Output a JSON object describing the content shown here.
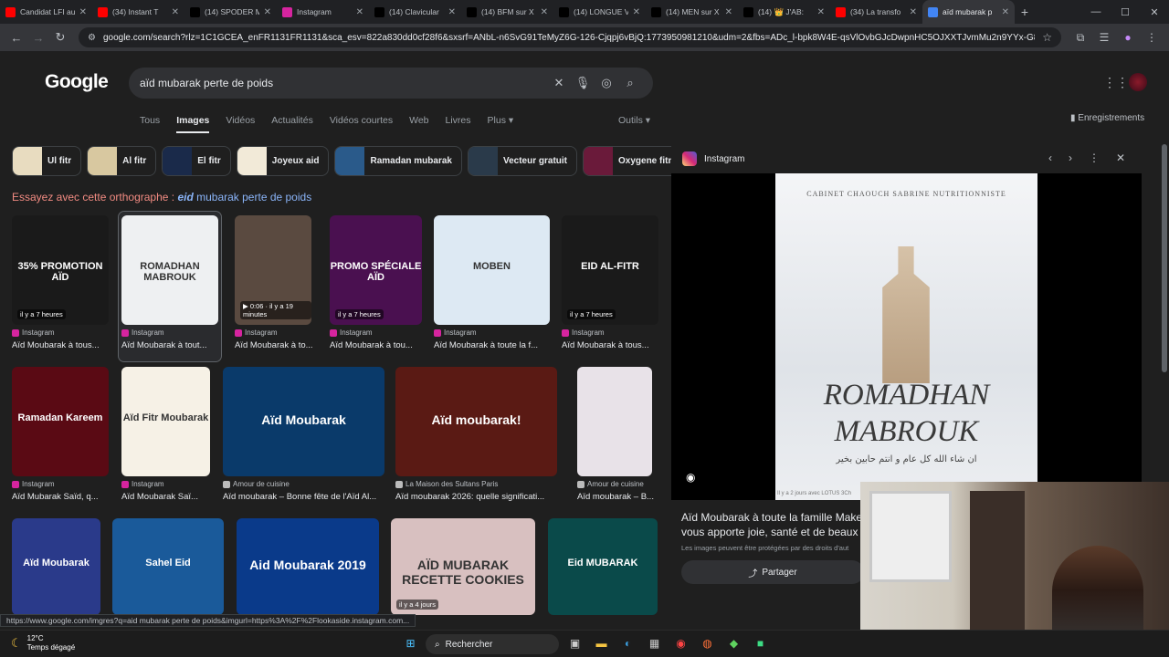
{
  "tabs": [
    {
      "title": "Candidat LFI au",
      "icon": "youtube-icon",
      "color": "#ff0000"
    },
    {
      "title": "(34) Instant T",
      "icon": "youtube-icon",
      "color": "#ff0000"
    },
    {
      "title": "(14) SPODER M",
      "icon": "x-icon",
      "color": "#000000"
    },
    {
      "title": "Instagram",
      "icon": "instagram-icon",
      "color": "#d6249f"
    },
    {
      "title": "(14) Clavicular",
      "icon": "x-icon",
      "color": "#000000"
    },
    {
      "title": "(14) BFM sur X",
      "icon": "x-icon",
      "color": "#000000"
    },
    {
      "title": "(14) LONGUE V",
      "icon": "x-icon",
      "color": "#000000"
    },
    {
      "title": "(14) MEN sur X",
      "icon": "x-icon",
      "color": "#000000"
    },
    {
      "title": "(14) 👑 J'AB:",
      "icon": "x-icon",
      "color": "#000000"
    },
    {
      "title": "(34) La transfo",
      "icon": "youtube-icon",
      "color": "#ff0000"
    },
    {
      "title": "aïd mubarak p",
      "icon": "google-icon",
      "color": "#4285f4"
    }
  ],
  "url": "google.com/search?rlz=1C1GCEA_enFR1131FR1131&sca_esv=822a830dd0cf28f6&sxsrf=ANbL-n6SvG91TeMyZ6G-126-Cjqpj6vBjQ:1773950981210&udm=2&fbs=ADc_l-bpk8W4E-qsVlOvbGJcDwpnHC5OJXXTJvmMu2n9YYx-G8xzgQk24aW1N_FyIND5...",
  "logo": "Google",
  "query": "aïd mubarak perte de poids",
  "navtabs": [
    "Tous",
    "Images",
    "Vidéos",
    "Actualités",
    "Vidéos courtes",
    "Web",
    "Livres",
    "Plus"
  ],
  "outils": "Outils",
  "enregistrements": "Enregistrements",
  "chips": [
    {
      "label": "Ul fitr",
      "color": "#e8dcc0"
    },
    {
      "label": "Al fitr",
      "color": "#d8c8a0"
    },
    {
      "label": "El fitr",
      "color": "#1a2a4a"
    },
    {
      "label": "Joyeux aid",
      "color": "#f2ead8"
    },
    {
      "label": "Ramadan mubarak",
      "color": "#2a5a8a"
    },
    {
      "label": "Vecteur gratuit",
      "color": "#2a3a4a"
    },
    {
      "label": "Oxygene fitness",
      "color": "#6a1a3a"
    }
  ],
  "spell": {
    "prefix": "Essayez avec cette orthographe : ",
    "fix": "eid",
    "rest": " mubarak perte de poids"
  },
  "results": [
    {
      "src": "Instagram",
      "title": "Aïd Moubarak à tous...",
      "badge": "il y a 7 heures",
      "overlay": "35% PROMOTION AÏD",
      "color": "#1a1a1a"
    },
    {
      "src": "Instagram",
      "title": "Aïd Moubarak à tout...",
      "badge": "",
      "overlay": "ROMADHAN MABROUK",
      "color": "#eef0f2"
    },
    {
      "src": "Instagram",
      "title": "Aïd Moubarak à to...",
      "badge": "▶ 0:06 · il y a 19 minutes",
      "overlay": "",
      "color": "#5a4a40"
    },
    {
      "src": "Instagram",
      "title": "Aïd Moubarak à tou...",
      "badge": "il y a 7 heures",
      "overlay": "PROMO SPÉCIALE AÏD",
      "color": "#4a1050"
    },
    {
      "src": "Instagram",
      "title": "Aïd Moubarak à toute la f...",
      "badge": "",
      "overlay": "MOBEN",
      "color": "#dde9f3"
    },
    {
      "src": "Instagram",
      "title": "Aïd Moubarak à tous...",
      "badge": "il y a 7 heures",
      "overlay": "EID AL-FITR",
      "color": "#1a1a1a"
    },
    {
      "src": "Instagram",
      "title": "Aïd Mubarak Saïd, q...",
      "badge": "",
      "overlay": "Ramadan Kareem",
      "color": "#5a0a14"
    },
    {
      "src": "Instagram",
      "title": "Aïd Moubarak Saï...",
      "badge": "",
      "overlay": "Aïd Fitr Moubarak",
      "color": "#f6f1e6"
    },
    {
      "src": "Amour de cuisine",
      "title": "Aïd moubarak – Bonne fête de l'Aïd Al...",
      "badge": "",
      "overlay": "Aïd Moubarak",
      "color": "#0a3a6a"
    },
    {
      "src": "La Maison des Sultans Paris",
      "title": "Aïd moubarak 2026: quelle significati...",
      "badge": "",
      "overlay": "Aïd moubarak!",
      "color": "#5a1a14"
    },
    {
      "src": "Amour de cuisine",
      "title": "Aïd moubarak – B...",
      "badge": "",
      "overlay": "",
      "color": "#e8e2e8"
    },
    {
      "src": "",
      "title": "",
      "badge": "",
      "overlay": "Aïd Moubarak",
      "color": "#2a3a8a"
    },
    {
      "src": "",
      "title": "",
      "badge": "",
      "overlay": "Sahel Eid",
      "color": "#1a5a9a"
    },
    {
      "src": "",
      "title": "",
      "badge": "",
      "overlay": "Aid Moubarak 2019",
      "color": "#0a3a8a"
    },
    {
      "src": "",
      "title": "",
      "badge": "il y a 4 jours",
      "overlay": "AÏD MUBARAK RECETTE COOKIES",
      "color": "#d8c0c0"
    },
    {
      "src": "",
      "title": "",
      "badge": "",
      "overlay": "Eid MUBARAK",
      "color": "#0a4a4a"
    }
  ],
  "panel": {
    "source": "Instagram",
    "header_text": "CABINET CHAOUCH SABRINE NUTRITIONNISTE",
    "headline1": "ROMADHAN",
    "headline2": "MABROUK",
    "arabic": "ان شاء الله كل عام و انتم حابين بخير",
    "footer": "Il y a 2 jours avec LOTUS 3Ch",
    "desc": "Aïd Moubarak à toute la famille Make vous apporte joie, santé et de beaux",
    "note": "Les images peuvent être protégées par des droits d'aut",
    "share": "Partager"
  },
  "status_url": "https://www.google.com/imgres?q=aid mubarak perte de poids&imgurl=https%3A%2F%2Flookaside.instagram.com...",
  "weather": {
    "temp": "12°C",
    "label": "Temps dégagé"
  },
  "taskbar_search": "Rechercher"
}
